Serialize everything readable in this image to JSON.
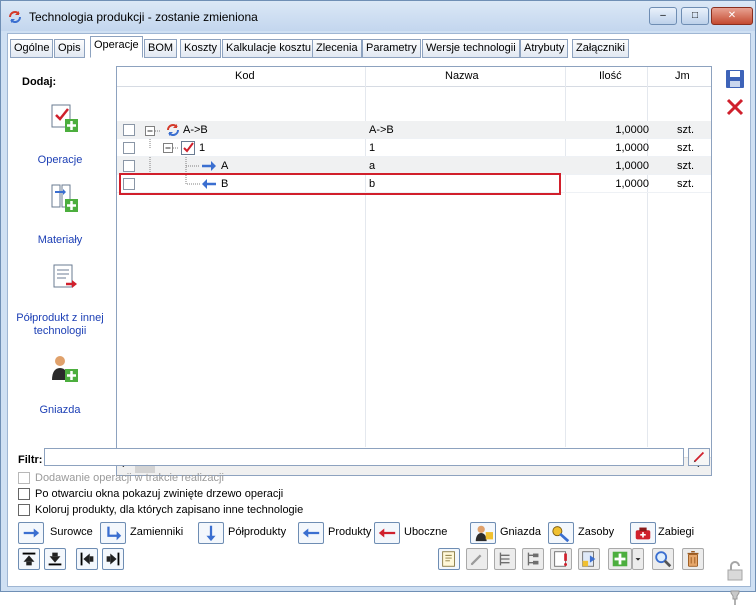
{
  "window": {
    "title": "Technologia produkcji - zostanie zmieniona",
    "controls": {
      "minimize": "–",
      "maximize": "□",
      "close": "✕"
    }
  },
  "tabs": [
    "Ogólne",
    "Opis",
    "Operacje",
    "BOM",
    "Koszty",
    "Kalkulacje kosztu",
    "Zlecenia",
    "Parametry",
    "Wersje technologii",
    "Atrybuty",
    "Załączniki"
  ],
  "active_tab": "Operacje",
  "left_panel": {
    "heading": "Dodaj:",
    "items": [
      {
        "label": "Operacje",
        "icon": "operation-add-icon"
      },
      {
        "label": "Materiały",
        "icon": "materials-add-icon"
      },
      {
        "label": "Półprodukt z innej technologii",
        "icon": "semi-product-import-icon"
      },
      {
        "label": "Gniazda",
        "icon": "workcenter-add-icon"
      }
    ]
  },
  "grid": {
    "columns": [
      "Kod",
      "Nazwa",
      "Ilość",
      "Jm"
    ],
    "rows": [
      {
        "kod": "A->B",
        "nazwa": "A->B",
        "ilosc": "1,0000",
        "jm": "szt.",
        "icon": "cycle-icon",
        "level": 0
      },
      {
        "kod": "1",
        "nazwa": "1",
        "ilosc": "1,0000",
        "jm": "szt.",
        "icon": "operation-check-icon",
        "level": 1
      },
      {
        "kod": "A",
        "nazwa": "a",
        "ilosc": "1,0000",
        "jm": "szt.",
        "icon": "arrow-right-icon",
        "level": 2
      },
      {
        "kod": "B",
        "nazwa": "b",
        "ilosc": "1,0000",
        "jm": "szt.",
        "icon": "arrow-left-icon",
        "level": 2
      }
    ]
  },
  "filter": {
    "label": "Filtr:",
    "value": ""
  },
  "options": [
    {
      "label": "Dodawanie operacji w trakcie realizacji",
      "disabled": true
    },
    {
      "label": "Po otwarciu okna pokazuj zwinięte drzewo operacji",
      "disabled": false
    },
    {
      "label": "Koloruj produkty, dla których zapisano inne technologie",
      "disabled": false
    }
  ],
  "legend_buttons": [
    "Surowce",
    "Zamienniki",
    "Półprodukty",
    "Produkty",
    "Uboczne",
    "Gniazda",
    "Zasoby",
    "Zabiegi"
  ],
  "colors": {
    "accent": "#1c3fb5",
    "highlight": "#d11f2b",
    "window": "#cfe0f3"
  }
}
